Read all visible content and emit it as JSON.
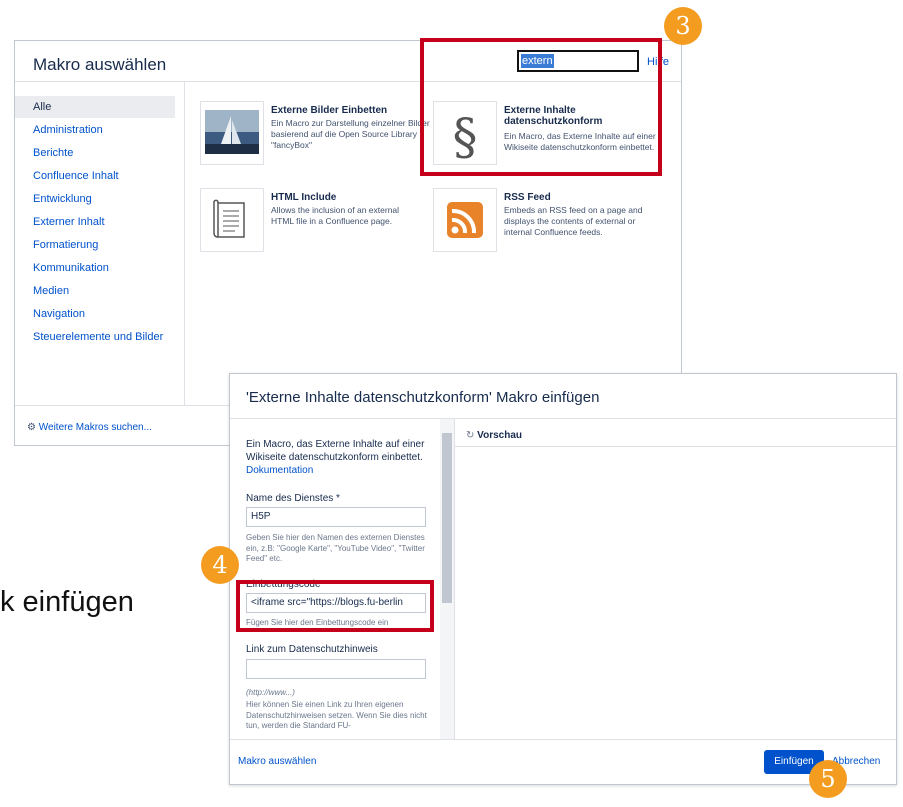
{
  "macro_dialog": {
    "title": "Makro auswählen",
    "search_value": "extern",
    "help_label": "Hilfe",
    "categories": [
      {
        "label": "Alle",
        "active": true
      },
      {
        "label": "Administration"
      },
      {
        "label": "Berichte"
      },
      {
        "label": "Confluence Inhalt"
      },
      {
        "label": "Entwicklung"
      },
      {
        "label": "Externer Inhalt"
      },
      {
        "label": "Formatierung"
      },
      {
        "label": "Kommunikation"
      },
      {
        "label": "Medien"
      },
      {
        "label": "Navigation"
      },
      {
        "label": "Steuerelemente und Bilder"
      }
    ],
    "more_macros_label": "Weitere Makros suchen...",
    "macros": [
      {
        "name": "Externe Bilder Einbetten",
        "desc": "Ein Macro zur Darstellung einzelner Bilder basierend auf die Open Source Library \"fancyBox\"",
        "icon": "image-icon"
      },
      {
        "name": "Externe Inhalte datenschutzkonform",
        "desc": "Ein Macro, das Externe Inhalte auf einer Wikiseite datenschutzkonform einbettet.",
        "icon": "paragraph-icon"
      },
      {
        "name": "HTML Include",
        "desc": "Allows the inclusion of an external HTML file in a Confluence page.",
        "icon": "document-icon"
      },
      {
        "name": "RSS Feed",
        "desc": "Embeds an RSS feed on a page and displays the contents of external or internal Confluence feeds.",
        "icon": "rss-icon"
      }
    ]
  },
  "badges": {
    "step3": "3",
    "step4": "4",
    "step5": "5"
  },
  "overlay_text": "k einfügen",
  "insert_dialog": {
    "title": "'Externe Inhalte datenschutzkonform' Makro einfügen",
    "intro": "Ein Macro, das Externe Inhalte auf einer Wikiseite datenschutzkonform einbettet.",
    "doc_link": "Dokumentation",
    "service_label": "Name des Dienstes *",
    "service_value": "H5P",
    "service_help": "Geben Sie hier den Namen des externen Dienstes ein, z.B: \"Google Karte\", \"YouTube Video\", \"Twitter Feed\" etc.",
    "embed_label": "Einbettungscode",
    "embed_value": "<iframe src=\"https://blogs.fu-berlin",
    "embed_help": "Fügen Sie hier den Einbettungscode ein",
    "privacy_label": "Link zum Datenschutzhinweis",
    "privacy_value": "",
    "privacy_hint": "(http://www...)",
    "privacy_help": "Hier können Sie einen Link zu Ihren eigenen Datenschutzhinweisen setzen. Wenn Sie dies nicht tun, werden die Standard FU-",
    "preview_label": "Vorschau",
    "back_link": "Makro auswählen",
    "insert_button": "Einfügen",
    "cancel_button": "Abbrechen"
  },
  "colors": {
    "highlight": "#c4001a",
    "badge": "#f39c1f",
    "primary": "#0052cc"
  }
}
